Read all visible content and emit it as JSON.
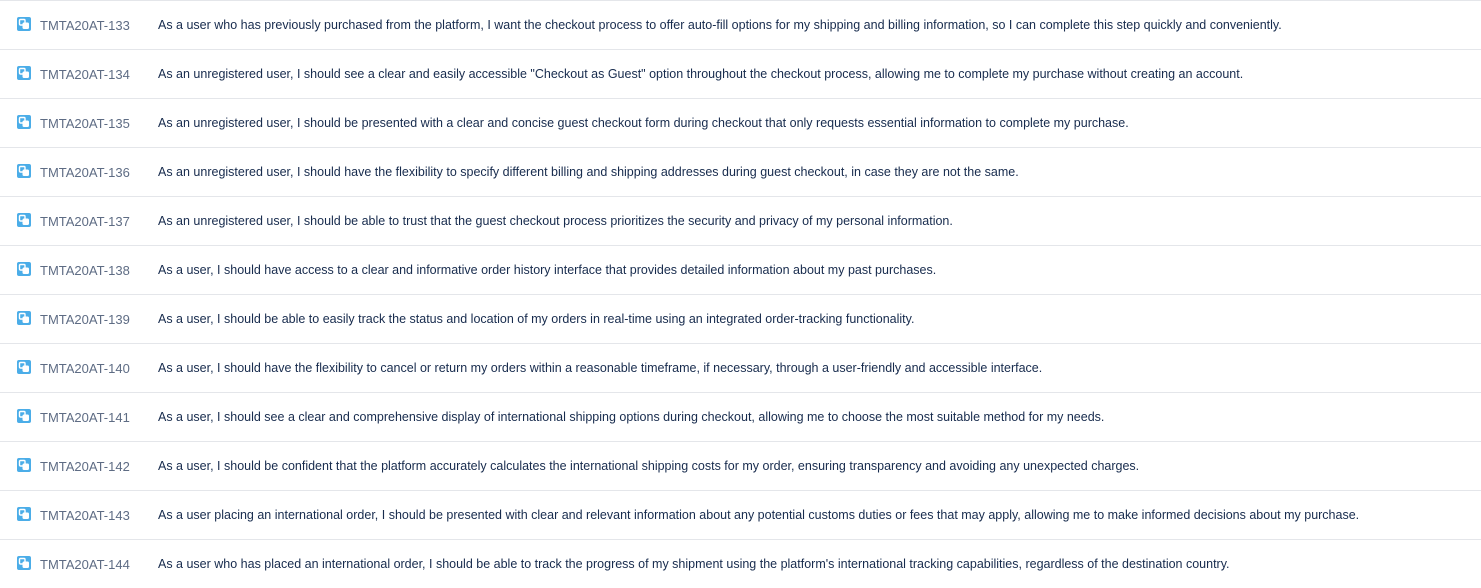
{
  "colors": {
    "story_icon": "#4bade8",
    "key_text": "#5e6c84",
    "summary_text": "#172b4d",
    "divider": "#e4e6ea"
  },
  "issues": [
    {
      "icon": "subtask-icon",
      "key": "TMTA20AT-133",
      "summary": "As a user who has previously purchased from the platform, I want the checkout process to offer auto-fill options for my shipping and billing information, so I can complete this step quickly and conveniently."
    },
    {
      "icon": "subtask-icon",
      "key": "TMTA20AT-134",
      "summary": "As an unregistered user, I should see a clear and easily accessible \"Checkout as Guest\" option throughout the checkout process, allowing me to complete my purchase without creating an account."
    },
    {
      "icon": "subtask-icon",
      "key": "TMTA20AT-135",
      "summary": "As an unregistered user, I should be presented with a clear and concise guest checkout form during checkout that only requests essential information to complete my purchase."
    },
    {
      "icon": "subtask-icon",
      "key": "TMTA20AT-136",
      "summary": "As an unregistered user, I should have the flexibility to specify different billing and shipping addresses during guest checkout, in case they are not the same."
    },
    {
      "icon": "subtask-icon",
      "key": "TMTA20AT-137",
      "summary": "As an unregistered user, I should be able to trust that the guest checkout process prioritizes the security and privacy of my personal information."
    },
    {
      "icon": "subtask-icon",
      "key": "TMTA20AT-138",
      "summary": "As a user, I should have access to a clear and informative order history interface that provides detailed information about my past purchases."
    },
    {
      "icon": "subtask-icon",
      "key": "TMTA20AT-139",
      "summary": "As a user, I should be able to easily track the status and location of my orders in real-time using an integrated order-tracking functionality."
    },
    {
      "icon": "subtask-icon",
      "key": "TMTA20AT-140",
      "summary": "As a user, I should have the flexibility to cancel or return my orders within a reasonable timeframe, if necessary, through a user-friendly and accessible interface."
    },
    {
      "icon": "subtask-icon",
      "key": "TMTA20AT-141",
      "summary": "As a user, I should see a clear and comprehensive display of international shipping options during checkout, allowing me to choose the most suitable method for my needs."
    },
    {
      "icon": "subtask-icon",
      "key": "TMTA20AT-142",
      "summary": "As a user, I should be confident that the platform accurately calculates the international shipping costs for my order, ensuring transparency and avoiding any unexpected charges."
    },
    {
      "icon": "subtask-icon",
      "key": "TMTA20AT-143",
      "summary": "As a user placing an international order, I should be presented with clear and relevant information about any potential customs duties or fees that may apply, allowing me to make informed decisions about my purchase."
    },
    {
      "icon": "subtask-icon",
      "key": "TMTA20AT-144",
      "summary": "As a user who has placed an international order, I should be able to track the progress of my shipment using the platform's international tracking capabilities, regardless of the destination country."
    }
  ]
}
